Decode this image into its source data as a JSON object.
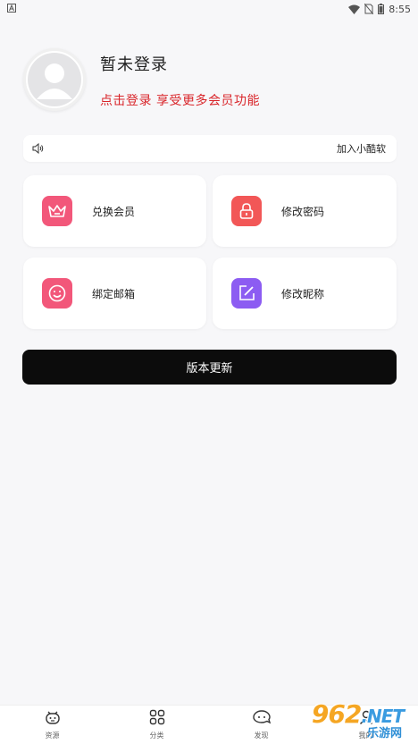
{
  "status_bar": {
    "time": "8:55",
    "left_icon": "a-letter-icon"
  },
  "profile": {
    "title": "暂未登录",
    "subtitle": "点击登录 享受更多会员功能"
  },
  "notice": {
    "right_text": "加入小酷软"
  },
  "cards": [
    {
      "label": "兑换会员",
      "icon": "crown-icon",
      "color": "#f2577a"
    },
    {
      "label": "修改密码",
      "icon": "lock-icon",
      "color": "#f25757"
    },
    {
      "label": "绑定邮箱",
      "icon": "smile-icon",
      "color": "#f2577a"
    },
    {
      "label": "修改昵称",
      "icon": "edit-icon",
      "color": "#8c5cf2"
    }
  ],
  "update_button": "版本更新",
  "tabs": [
    {
      "label": "资源",
      "icon": "mascot-icon"
    },
    {
      "label": "分类",
      "icon": "grid-icon"
    },
    {
      "label": "发现",
      "icon": "bubble-icon"
    },
    {
      "label": "我的",
      "icon": "user-icon"
    }
  ],
  "watermark": {
    "main": "962",
    "net": ".NET",
    "sub": "乐游网"
  }
}
